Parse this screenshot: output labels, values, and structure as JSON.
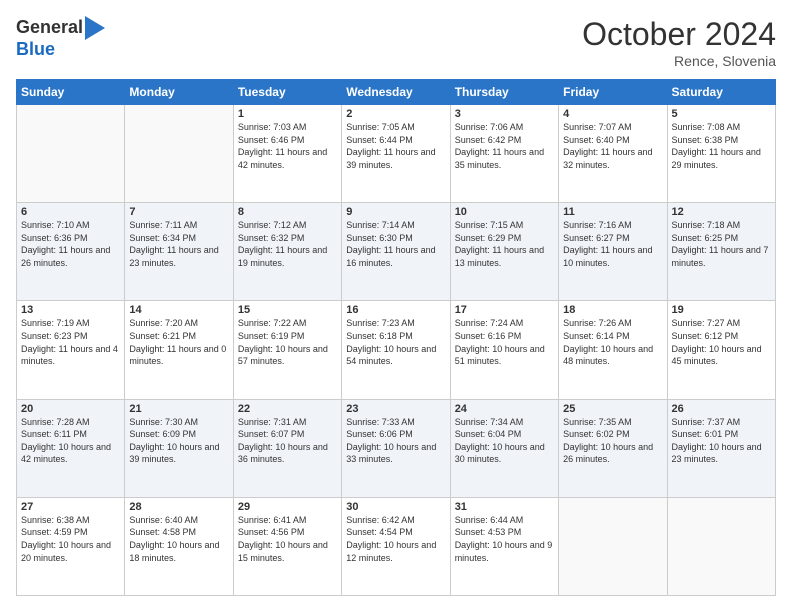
{
  "logo": {
    "general": "General",
    "blue": "Blue"
  },
  "title": "October 2024",
  "location": "Rence, Slovenia",
  "days_header": [
    "Sunday",
    "Monday",
    "Tuesday",
    "Wednesday",
    "Thursday",
    "Friday",
    "Saturday"
  ],
  "weeks": [
    [
      {
        "day": "",
        "sunrise": "",
        "sunset": "",
        "daylight": ""
      },
      {
        "day": "",
        "sunrise": "",
        "sunset": "",
        "daylight": ""
      },
      {
        "day": "1",
        "sunrise": "Sunrise: 7:03 AM",
        "sunset": "Sunset: 6:46 PM",
        "daylight": "Daylight: 11 hours and 42 minutes."
      },
      {
        "day": "2",
        "sunrise": "Sunrise: 7:05 AM",
        "sunset": "Sunset: 6:44 PM",
        "daylight": "Daylight: 11 hours and 39 minutes."
      },
      {
        "day": "3",
        "sunrise": "Sunrise: 7:06 AM",
        "sunset": "Sunset: 6:42 PM",
        "daylight": "Daylight: 11 hours and 35 minutes."
      },
      {
        "day": "4",
        "sunrise": "Sunrise: 7:07 AM",
        "sunset": "Sunset: 6:40 PM",
        "daylight": "Daylight: 11 hours and 32 minutes."
      },
      {
        "day": "5",
        "sunrise": "Sunrise: 7:08 AM",
        "sunset": "Sunset: 6:38 PM",
        "daylight": "Daylight: 11 hours and 29 minutes."
      }
    ],
    [
      {
        "day": "6",
        "sunrise": "Sunrise: 7:10 AM",
        "sunset": "Sunset: 6:36 PM",
        "daylight": "Daylight: 11 hours and 26 minutes."
      },
      {
        "day": "7",
        "sunrise": "Sunrise: 7:11 AM",
        "sunset": "Sunset: 6:34 PM",
        "daylight": "Daylight: 11 hours and 23 minutes."
      },
      {
        "day": "8",
        "sunrise": "Sunrise: 7:12 AM",
        "sunset": "Sunset: 6:32 PM",
        "daylight": "Daylight: 11 hours and 19 minutes."
      },
      {
        "day": "9",
        "sunrise": "Sunrise: 7:14 AM",
        "sunset": "Sunset: 6:30 PM",
        "daylight": "Daylight: 11 hours and 16 minutes."
      },
      {
        "day": "10",
        "sunrise": "Sunrise: 7:15 AM",
        "sunset": "Sunset: 6:29 PM",
        "daylight": "Daylight: 11 hours and 13 minutes."
      },
      {
        "day": "11",
        "sunrise": "Sunrise: 7:16 AM",
        "sunset": "Sunset: 6:27 PM",
        "daylight": "Daylight: 11 hours and 10 minutes."
      },
      {
        "day": "12",
        "sunrise": "Sunrise: 7:18 AM",
        "sunset": "Sunset: 6:25 PM",
        "daylight": "Daylight: 11 hours and 7 minutes."
      }
    ],
    [
      {
        "day": "13",
        "sunrise": "Sunrise: 7:19 AM",
        "sunset": "Sunset: 6:23 PM",
        "daylight": "Daylight: 11 hours and 4 minutes."
      },
      {
        "day": "14",
        "sunrise": "Sunrise: 7:20 AM",
        "sunset": "Sunset: 6:21 PM",
        "daylight": "Daylight: 11 hours and 0 minutes."
      },
      {
        "day": "15",
        "sunrise": "Sunrise: 7:22 AM",
        "sunset": "Sunset: 6:19 PM",
        "daylight": "Daylight: 10 hours and 57 minutes."
      },
      {
        "day": "16",
        "sunrise": "Sunrise: 7:23 AM",
        "sunset": "Sunset: 6:18 PM",
        "daylight": "Daylight: 10 hours and 54 minutes."
      },
      {
        "day": "17",
        "sunrise": "Sunrise: 7:24 AM",
        "sunset": "Sunset: 6:16 PM",
        "daylight": "Daylight: 10 hours and 51 minutes."
      },
      {
        "day": "18",
        "sunrise": "Sunrise: 7:26 AM",
        "sunset": "Sunset: 6:14 PM",
        "daylight": "Daylight: 10 hours and 48 minutes."
      },
      {
        "day": "19",
        "sunrise": "Sunrise: 7:27 AM",
        "sunset": "Sunset: 6:12 PM",
        "daylight": "Daylight: 10 hours and 45 minutes."
      }
    ],
    [
      {
        "day": "20",
        "sunrise": "Sunrise: 7:28 AM",
        "sunset": "Sunset: 6:11 PM",
        "daylight": "Daylight: 10 hours and 42 minutes."
      },
      {
        "day": "21",
        "sunrise": "Sunrise: 7:30 AM",
        "sunset": "Sunset: 6:09 PM",
        "daylight": "Daylight: 10 hours and 39 minutes."
      },
      {
        "day": "22",
        "sunrise": "Sunrise: 7:31 AM",
        "sunset": "Sunset: 6:07 PM",
        "daylight": "Daylight: 10 hours and 36 minutes."
      },
      {
        "day": "23",
        "sunrise": "Sunrise: 7:33 AM",
        "sunset": "Sunset: 6:06 PM",
        "daylight": "Daylight: 10 hours and 33 minutes."
      },
      {
        "day": "24",
        "sunrise": "Sunrise: 7:34 AM",
        "sunset": "Sunset: 6:04 PM",
        "daylight": "Daylight: 10 hours and 30 minutes."
      },
      {
        "day": "25",
        "sunrise": "Sunrise: 7:35 AM",
        "sunset": "Sunset: 6:02 PM",
        "daylight": "Daylight: 10 hours and 26 minutes."
      },
      {
        "day": "26",
        "sunrise": "Sunrise: 7:37 AM",
        "sunset": "Sunset: 6:01 PM",
        "daylight": "Daylight: 10 hours and 23 minutes."
      }
    ],
    [
      {
        "day": "27",
        "sunrise": "Sunrise: 6:38 AM",
        "sunset": "Sunset: 4:59 PM",
        "daylight": "Daylight: 10 hours and 20 minutes."
      },
      {
        "day": "28",
        "sunrise": "Sunrise: 6:40 AM",
        "sunset": "Sunset: 4:58 PM",
        "daylight": "Daylight: 10 hours and 18 minutes."
      },
      {
        "day": "29",
        "sunrise": "Sunrise: 6:41 AM",
        "sunset": "Sunset: 4:56 PM",
        "daylight": "Daylight: 10 hours and 15 minutes."
      },
      {
        "day": "30",
        "sunrise": "Sunrise: 6:42 AM",
        "sunset": "Sunset: 4:54 PM",
        "daylight": "Daylight: 10 hours and 12 minutes."
      },
      {
        "day": "31",
        "sunrise": "Sunrise: 6:44 AM",
        "sunset": "Sunset: 4:53 PM",
        "daylight": "Daylight: 10 hours and 9 minutes."
      },
      {
        "day": "",
        "sunrise": "",
        "sunset": "",
        "daylight": ""
      },
      {
        "day": "",
        "sunrise": "",
        "sunset": "",
        "daylight": ""
      }
    ]
  ]
}
